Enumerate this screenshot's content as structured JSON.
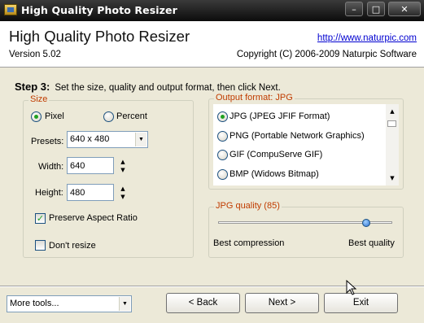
{
  "window": {
    "title": "High Quality Photo Resizer"
  },
  "header": {
    "app_title": "High Quality Photo Resizer",
    "version": "Version 5.02",
    "url": "http://www.naturpic.com",
    "copyright": "Copyright (C) 2006-2009 Naturpic Software"
  },
  "step": {
    "label": "Step 3:",
    "text": "Set the size, quality and output format, then click Next."
  },
  "size": {
    "group_label": "Size",
    "mode_options": [
      "Pixel",
      "Percent"
    ],
    "mode_selected": "Pixel",
    "presets_label": "Presets:",
    "presets_value": "640 x 480",
    "width_label": "Width:",
    "width_value": "640",
    "height_label": "Height:",
    "height_value": "480",
    "preserve_aspect_label": "Preserve Aspect Ratio",
    "preserve_aspect_checked": true,
    "dont_resize_label": "Don't resize",
    "dont_resize_checked": false
  },
  "output": {
    "group_label": "Output format: JPG",
    "formats": [
      {
        "label": "JPG (JPEG JFIF Format)",
        "selected": true
      },
      {
        "label": "PNG (Portable Network Graphics)",
        "selected": false
      },
      {
        "label": "GIF (CompuServe GIF)",
        "selected": false
      },
      {
        "label": "BMP (Widows Bitmap)",
        "selected": false
      }
    ]
  },
  "quality": {
    "group_label": "JPG quality (85)",
    "value": 85,
    "min_label": "Best compression",
    "max_label": "Best quality"
  },
  "footer": {
    "more_tools": "More tools...",
    "back": "< Back",
    "next": "Next >",
    "exit": "Exit"
  },
  "colors": {
    "group_label": "#c03c00",
    "link": "#0000d0",
    "selected_radio": "#21a121",
    "background": "#ece9d8"
  },
  "icons": [
    "app-icon",
    "minimize-icon",
    "maximize-icon",
    "close-icon",
    "chevron-down-icon",
    "spin-up-icon",
    "spin-down-icon",
    "mouse-cursor-icon"
  ]
}
